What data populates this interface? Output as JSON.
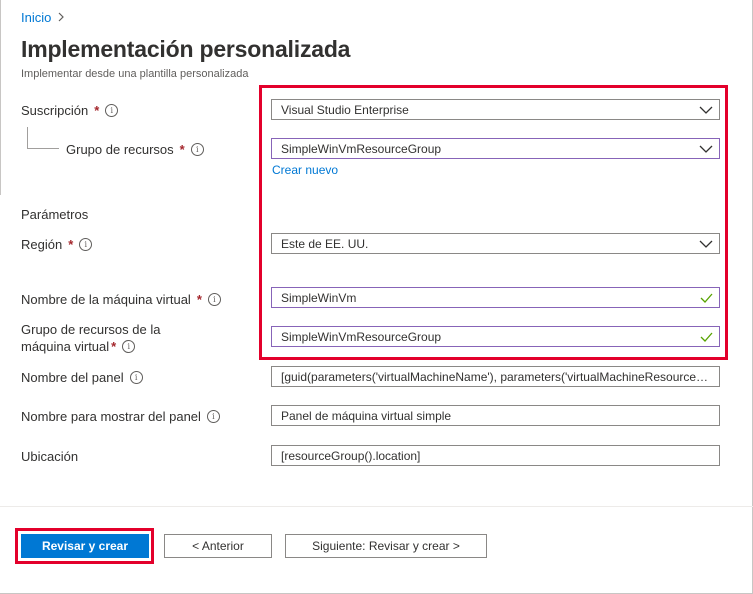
{
  "breadcrumb": {
    "home": "Inicio"
  },
  "header": {
    "title": "Implementación personalizada",
    "subtitle": "Implementar desde una plantilla personalizada"
  },
  "required_marker": "*",
  "info_glyph": "i",
  "form": {
    "subscription": {
      "label": "Suscripción",
      "value": "Visual Studio Enterprise"
    },
    "resource_group": {
      "label": "Grupo de recursos",
      "value": "SimpleWinVmResourceGroup",
      "create_new": "Crear nuevo"
    },
    "parameters_heading": "Parámetros",
    "region": {
      "label": "Región",
      "value": "Este de EE. UU."
    },
    "vm_name": {
      "label": "Nombre de la máquina virtual",
      "value": "SimpleWinVm"
    },
    "vm_resource_group": {
      "label_line1": "Grupo de recursos de la",
      "label_line2": "máquina virtual",
      "value": "SimpleWinVmResourceGroup"
    },
    "dashboard_name": {
      "label": "Nombre del panel",
      "value": "[guid(parameters('virtualMachineName'), parameters('virtualMachineResourceGroup'))]"
    },
    "dashboard_display_name": {
      "label": "Nombre para mostrar del panel",
      "value": "Panel de máquina virtual simple"
    },
    "location": {
      "label": "Ubicación",
      "value": "[resourceGroup().location]"
    }
  },
  "footer": {
    "review_create": "Revisar y crear",
    "previous": "< Anterior",
    "next": "Siguiente: Revisar y crear >"
  },
  "colors": {
    "accent": "#0078d4",
    "highlight": "#e3002b",
    "valid_check": "#57a300",
    "required": "#a4262c"
  }
}
